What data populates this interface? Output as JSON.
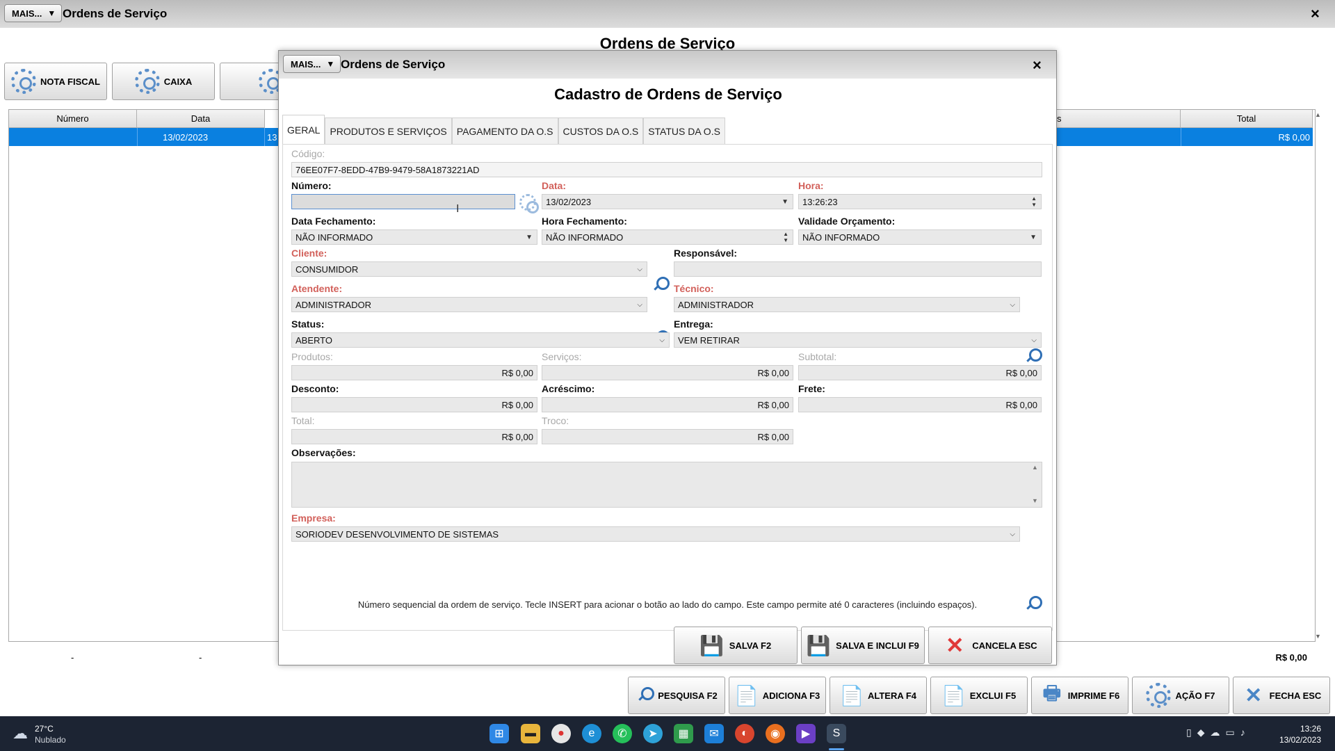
{
  "main": {
    "mais_label": "MAIS...",
    "mais_arrow": "▼",
    "title": "Ordens de Serviço",
    "close": "×",
    "heading": "Ordens de Serviço",
    "top_buttons": [
      {
        "label": "NOTA FISCAL",
        "icon": "gear-icon"
      },
      {
        "label": "CAIXA",
        "icon": "gear-icon"
      },
      {
        "label": "",
        "icon": "gear-icon"
      }
    ],
    "grid_headers": [
      "Número",
      "Data",
      "s",
      "Total"
    ],
    "grid_row": {
      "data": "13/02/2023",
      "partial": "13",
      "total": "R$ 0,00"
    },
    "footer": {
      "c1": "-",
      "c2": "-",
      "total": "R$ 0,00"
    },
    "bottom_buttons": [
      {
        "label": "PESQUISA F2",
        "icon": "search-icon"
      },
      {
        "label": "ADICIONA F3",
        "icon": "add-document-icon"
      },
      {
        "label": "ALTERA F4",
        "icon": "edit-document-icon"
      },
      {
        "label": "EXCLUI F5",
        "icon": "delete-document-icon"
      },
      {
        "label": "IMPRIME F6",
        "icon": "printer-icon"
      },
      {
        "label": "AÇÃO F7",
        "icon": "gear-icon"
      },
      {
        "label": "FECHA ESC",
        "icon": "close-icon"
      }
    ]
  },
  "dialog": {
    "mais_label": "MAIS...",
    "title": "Ordens de Serviço",
    "close": "×",
    "heading": "Cadastro de Ordens de Serviço",
    "tabs": [
      "GERAL",
      "PRODUTOS E SERVIÇOS",
      "PAGAMENTO DA O.S",
      "CUSTOS DA O.S",
      "STATUS DA O.S"
    ],
    "codigo": {
      "label": "Código:",
      "value": "76EE07F7-8EDD-47B9-9479-58A1873221AD"
    },
    "numero": {
      "label": "Número:",
      "value": ""
    },
    "data": {
      "label": "Data:",
      "value": "13/02/2023"
    },
    "hora": {
      "label": "Hora:",
      "value": "13:26:23"
    },
    "data_fechamento": {
      "label": "Data Fechamento:",
      "value": "NÃO INFORMADO"
    },
    "hora_fechamento": {
      "label": "Hora Fechamento:",
      "value": "NÃO INFORMADO"
    },
    "validade": {
      "label": "Validade Orçamento:",
      "value": "NÃO INFORMADO"
    },
    "cliente": {
      "label": "Cliente:",
      "value": "CONSUMIDOR"
    },
    "responsavel": {
      "label": "Responsável:",
      "value": ""
    },
    "atendente": {
      "label": "Atendente:",
      "value": "ADMINISTRADOR"
    },
    "tecnico": {
      "label": "Técnico:",
      "value": "ADMINISTRADOR"
    },
    "status": {
      "label": "Status:",
      "value": "ABERTO"
    },
    "entrega": {
      "label": "Entrega:",
      "value": "VEM RETIRAR"
    },
    "produtos": {
      "label": "Produtos:",
      "value": "R$ 0,00"
    },
    "servicos": {
      "label": "Serviços:",
      "value": "R$ 0,00"
    },
    "subtotal": {
      "label": "Subtotal:",
      "value": "R$ 0,00"
    },
    "desconto": {
      "label": "Desconto:",
      "value": "R$ 0,00"
    },
    "acrescimo": {
      "label": "Acréscimo:",
      "value": "R$ 0,00"
    },
    "frete": {
      "label": "Frete:",
      "value": "R$ 0,00"
    },
    "total": {
      "label": "Total:",
      "value": "R$ 0,00"
    },
    "troco": {
      "label": "Troco:",
      "value": "R$ 0,00"
    },
    "observacoes": {
      "label": "Observações:",
      "value": ""
    },
    "empresa": {
      "label": "Empresa:",
      "value": "SORIODEV DESENVOLVIMENTO DE SISTEMAS"
    },
    "hint": "Número sequencial da ordem de serviço. Tecle INSERT para acionar o botão ao lado do campo. Este campo permite até 0 caracteres (incluindo espaços).",
    "buttons": [
      {
        "label": "SALVA F2",
        "icon": "save-icon"
      },
      {
        "label": "SALVA E INCLUI F9",
        "icon": "save-add-icon"
      },
      {
        "label": "CANCELA ESC",
        "icon": "cancel-icon"
      }
    ]
  },
  "taskbar": {
    "weather_temp": "27°C",
    "weather_desc": "Nublado",
    "time": "13:26",
    "date": "13/02/2023"
  },
  "colors": {
    "selection": "#0a80e0",
    "required_label": "#d2605a",
    "icon_blue": "#2f6fb5"
  }
}
